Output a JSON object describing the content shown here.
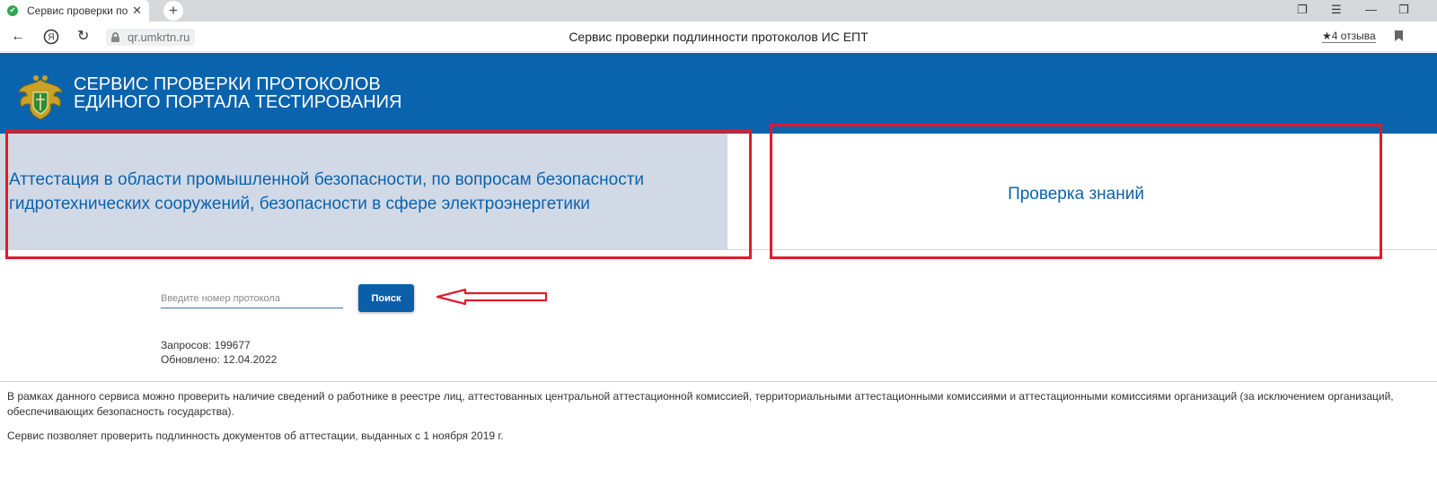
{
  "browser": {
    "tab_title": "Сервис проверки подл",
    "tab_close": "✕",
    "new_tab": "+",
    "url": "qr.umkrtn.ru",
    "page_title": "Сервис проверки подлинности протоколов ИС ЕПТ",
    "reviews": "4 отзыва"
  },
  "header": {
    "title_line1": "СЕРВИС ПРОВЕРКИ ПРОТОКОЛОВ",
    "title_line2": "ЕДИНОГО ПОРТАЛА ТЕСТИРОВАНИЯ"
  },
  "panels": {
    "left_line1": "Аттестация в области промышленной безопасности, по вопросам безопасности",
    "left_line2": "гидротехнических сооружений, безопасности в сфере электроэнергетики",
    "right": "Проверка знаний"
  },
  "search": {
    "placeholder": "Введите номер протокола",
    "value": "",
    "button_label": "Поиск"
  },
  "stats": {
    "requests": "Запросов: 199677",
    "updated": "Обновлено: 12.04.2022"
  },
  "info": {
    "line1": "В рамках данного сервиса можно проверить наличие сведений о работнике в реестре лиц, аттестованных центральной аттестационной комиссией, территориальными аттестационными комиссиями и аттестационными комиссиями организаций (за исключением организаций,",
    "line2": "обеспечивающих безопасность государства).",
    "line3": "Сервис позволяет проверить подлинность документов об аттестации, выданных с 1 ноября 2019 г."
  },
  "colors": {
    "brand_blue": "#0a63ad",
    "panel_grey": "#d1d9e6",
    "annotation_red": "#e11b2a"
  },
  "icons": [
    "tab-favicon-icon",
    "close-icon",
    "plus-icon",
    "back-arrow-icon",
    "yandex-icon",
    "reload-icon",
    "lock-icon",
    "star-icon",
    "bookmark-icon",
    "emblem-icon",
    "annotation-arrow-icon"
  ]
}
